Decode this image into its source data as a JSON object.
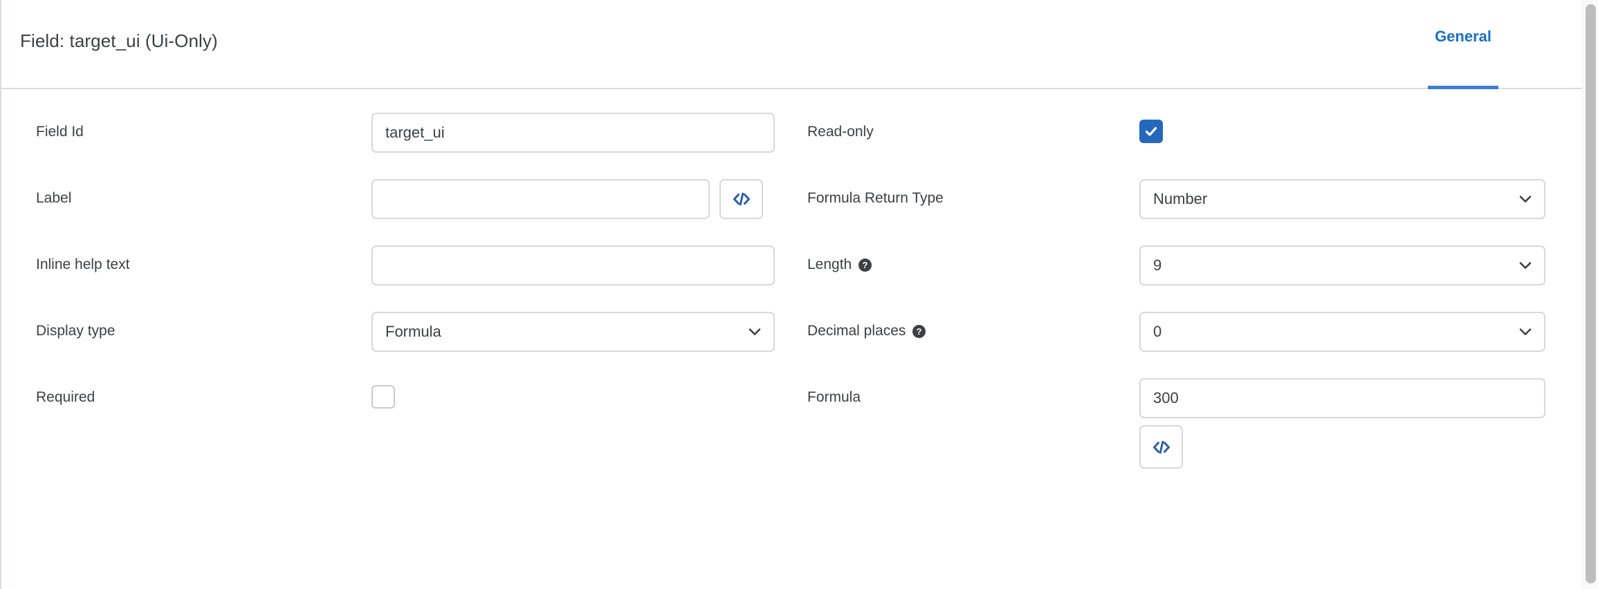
{
  "header": {
    "title": "Field: target_ui (Ui-Only)",
    "tabs": [
      {
        "label": "General",
        "active": true
      }
    ]
  },
  "form": {
    "left_column": [
      {
        "label": "Field Id",
        "control": "text",
        "value": "target_ui",
        "placeholder": ""
      },
      {
        "label": "Label",
        "control": "text-with-code-button",
        "value": "",
        "placeholder": "",
        "code_button_icon": "code-icon"
      },
      {
        "label": "Inline help text",
        "control": "text",
        "value": "",
        "placeholder": ""
      },
      {
        "label": "Display type",
        "control": "select",
        "value": "Formula"
      },
      {
        "label": "Required",
        "control": "checkbox",
        "checked": false
      }
    ],
    "right_column": [
      {
        "label": "Read-only",
        "control": "checkbox",
        "checked": true
      },
      {
        "label": "Formula Return Type",
        "control": "select",
        "value": "Number"
      },
      {
        "label": "Length",
        "help": "help-icon",
        "control": "select",
        "value": "9"
      },
      {
        "label": "Decimal places",
        "help": "help-icon",
        "control": "select",
        "value": "0"
      },
      {
        "label": "Formula",
        "control": "text-with-code-button-below",
        "value": "300",
        "placeholder": "",
        "code_button_icon": "code-icon"
      }
    ]
  },
  "colors": {
    "accent": "#1a6fc4",
    "tab_underline": "#3b7dd8",
    "checkbox_checked": "#2468bd",
    "code_icon": "#2a5caa",
    "border": "#d6d8dc",
    "text": "#3c4043"
  }
}
